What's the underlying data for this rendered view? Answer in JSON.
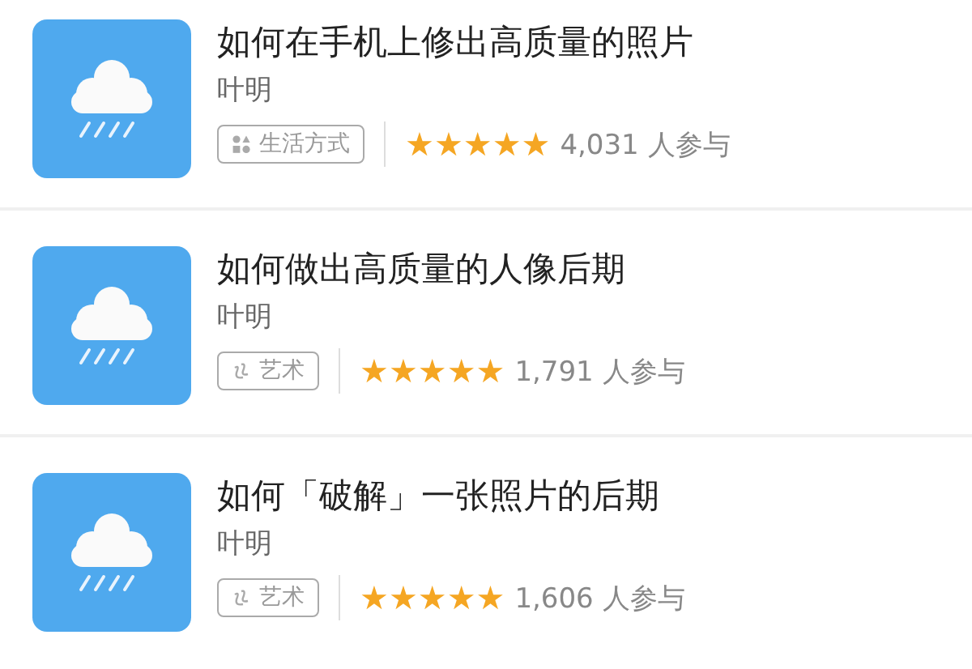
{
  "courses": [
    {
      "title": "如何在手机上修出高质量的照片",
      "author": "叶明",
      "tag": {
        "kind": "lifestyle",
        "label": "生活方式"
      },
      "stars": 5,
      "participants": "4,031 人参与"
    },
    {
      "title": "如何做出高质量的人像后期",
      "author": "叶明",
      "tag": {
        "kind": "art",
        "label": "艺术"
      },
      "stars": 5,
      "participants": "1,791 人参与"
    },
    {
      "title": "如何「破解」一张照片的后期",
      "author": "叶明",
      "tag": {
        "kind": "art",
        "label": "艺术"
      },
      "stars": 5,
      "participants": "1,606 人参与"
    }
  ]
}
